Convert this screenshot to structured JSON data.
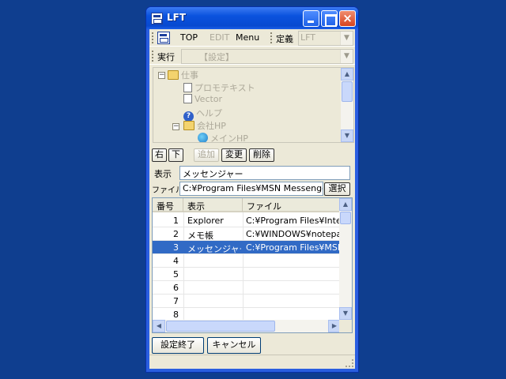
{
  "window": {
    "title": "LFT"
  },
  "toolbar1": {
    "top": "TOP",
    "edit": "EDIT",
    "menu": "Menu",
    "teigi_label": "定義",
    "teigi_value": "LFT"
  },
  "toolbar2": {
    "jikkou_label": "実行",
    "settei_value": "【設定】"
  },
  "tree": {
    "nodes": [
      {
        "label": "仕事",
        "icon": "folder-icon"
      },
      {
        "label": "プロモテキスト",
        "icon": "document-icon"
      },
      {
        "label": "Vector",
        "icon": "document-icon"
      },
      {
        "label": "ヘルプ",
        "icon": "help-icon"
      },
      {
        "label": "会社HP",
        "icon": "folder-icon"
      },
      {
        "label": "メインHP",
        "icon": "globe-icon"
      }
    ]
  },
  "buttons": {
    "right": "右",
    "down": "下",
    "add": "追加",
    "change": "変更",
    "delete": "削除",
    "select": "選択",
    "finish": "設定終了",
    "cancel": "キャンセル"
  },
  "form": {
    "hyouji_label": "表示",
    "hyouji_value": "メッセンジャー",
    "file_label": "ファイル",
    "file_value": "C:¥Program Files¥MSN Messenger"
  },
  "list": {
    "headers": [
      "番号",
      "表示",
      "ファイル"
    ],
    "rows": [
      {
        "num": "1",
        "disp": "Explorer",
        "file": "C:¥Program Files¥Interr"
      },
      {
        "num": "2",
        "disp": "メモ帳",
        "file": "C:¥WINDOWS¥notepad.e"
      },
      {
        "num": "3",
        "disp": "メッセンジャー",
        "file": "C:¥Program Files¥MSN"
      },
      {
        "num": "4",
        "disp": "",
        "file": ""
      },
      {
        "num": "5",
        "disp": "",
        "file": ""
      },
      {
        "num": "6",
        "disp": "",
        "file": ""
      },
      {
        "num": "7",
        "disp": "",
        "file": ""
      },
      {
        "num": "8",
        "disp": "",
        "file": ""
      }
    ],
    "selected_row": 3
  },
  "colors": {
    "desktop": "#0f3e8f",
    "titlebar": "#0a52de",
    "selection": "#316ac5",
    "face": "#ece9d8"
  }
}
